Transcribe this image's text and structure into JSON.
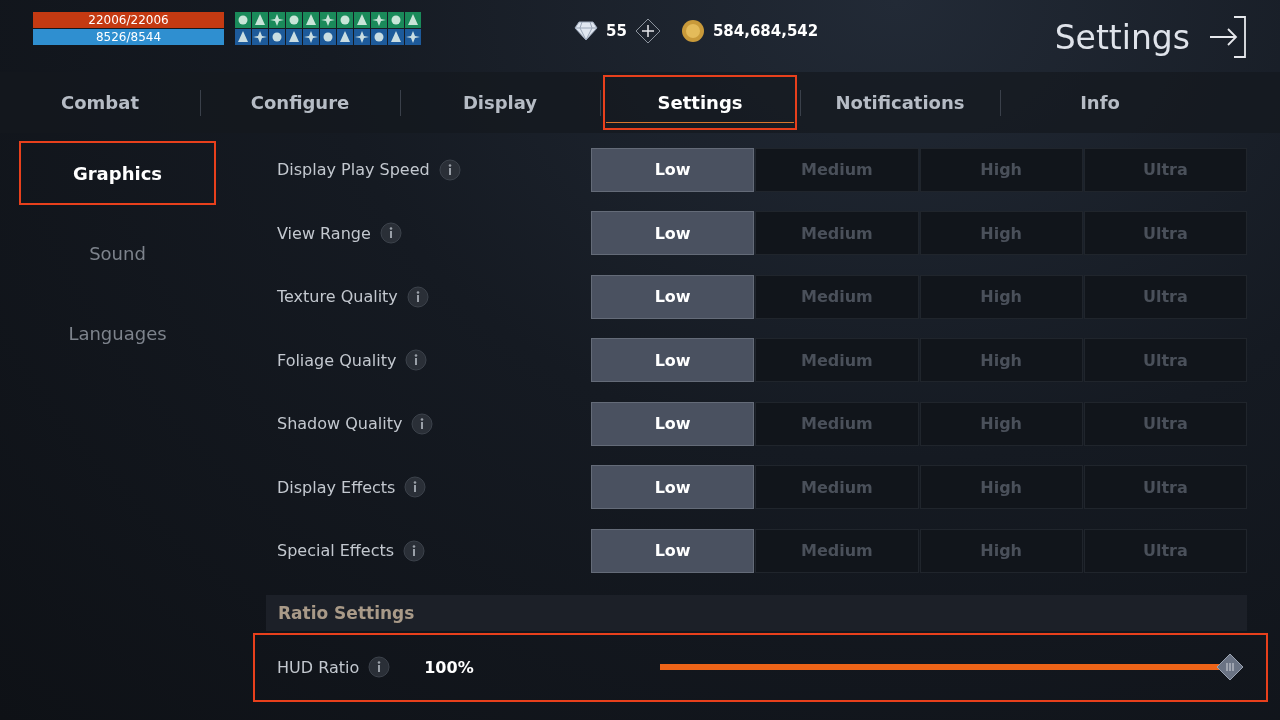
{
  "status": {
    "health": {
      "text": "22006/22006",
      "level": 1
    },
    "mana": {
      "text": "8526/8544",
      "level": 0.998
    }
  },
  "currency": {
    "gems": "55",
    "gold": "584,684,542"
  },
  "window": {
    "title": "Settings"
  },
  "tabs": [
    {
      "label": "Combat",
      "selected": false,
      "highlighted": false
    },
    {
      "label": "Configure",
      "selected": false,
      "highlighted": false
    },
    {
      "label": "Display",
      "selected": false,
      "highlighted": false
    },
    {
      "label": "Settings",
      "selected": true,
      "highlighted": true
    },
    {
      "label": "Notifications",
      "selected": false,
      "highlighted": false
    },
    {
      "label": "Info",
      "selected": false,
      "highlighted": false
    }
  ],
  "sidebar": {
    "items": [
      {
        "label": "Graphics",
        "selected": true,
        "highlighted": true
      },
      {
        "label": "Sound",
        "selected": false,
        "highlighted": false
      },
      {
        "label": "Languages",
        "selected": false,
        "highlighted": false
      }
    ]
  },
  "settings": [
    {
      "label": "Display Play Speed",
      "options": [
        {
          "label": "Low",
          "selected": true
        },
        {
          "label": "Medium",
          "selected": false
        },
        {
          "label": "High",
          "selected": false
        },
        {
          "label": "Ultra",
          "selected": false
        }
      ]
    },
    {
      "label": "View Range",
      "options": [
        {
          "label": "Low",
          "selected": true
        },
        {
          "label": "Medium",
          "selected": false
        },
        {
          "label": "High",
          "selected": false
        },
        {
          "label": "Ultra",
          "selected": false
        }
      ]
    },
    {
      "label": "Texture Quality",
      "options": [
        {
          "label": "Low",
          "selected": true
        },
        {
          "label": "Medium",
          "selected": false
        },
        {
          "label": "High",
          "selected": false
        },
        {
          "label": "Ultra",
          "selected": false
        }
      ]
    },
    {
      "label": "Foliage Quality",
      "options": [
        {
          "label": "Low",
          "selected": true
        },
        {
          "label": "Medium",
          "selected": false
        },
        {
          "label": "High",
          "selected": false
        },
        {
          "label": "Ultra",
          "selected": false
        }
      ]
    },
    {
      "label": "Shadow Quality",
      "options": [
        {
          "label": "Low",
          "selected": true
        },
        {
          "label": "Medium",
          "selected": false
        },
        {
          "label": "High",
          "selected": false
        },
        {
          "label": "Ultra",
          "selected": false
        }
      ]
    },
    {
      "label": "Display Effects",
      "options": [
        {
          "label": "Low",
          "selected": true
        },
        {
          "label": "Medium",
          "selected": false
        },
        {
          "label": "High",
          "selected": false
        },
        {
          "label": "Ultra",
          "selected": false
        }
      ]
    },
    {
      "label": "Special Effects",
      "options": [
        {
          "label": "Low",
          "selected": true
        },
        {
          "label": "Medium",
          "selected": false
        },
        {
          "label": "High",
          "selected": false
        },
        {
          "label": "Ultra",
          "selected": false
        }
      ]
    }
  ],
  "ratio_settings": {
    "title": "Ratio Settings",
    "rows": [
      {
        "label": "HUD Ratio",
        "reading": "100%",
        "level": 1,
        "highlighted": true
      }
    ]
  }
}
